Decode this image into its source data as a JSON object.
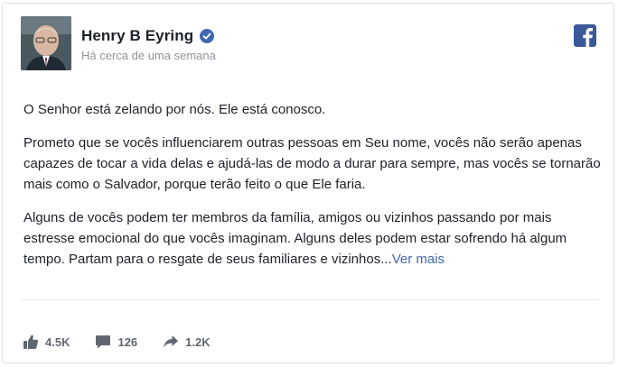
{
  "post": {
    "author": "Henry B Eyring",
    "time": "Há cerca de uma semana",
    "paragraphs": [
      "O Senhor está zelando por nós. Ele está conosco.",
      "Prometo que se vocês influenciarem outras pessoas em Seu nome, vocês não serão apenas capazes de tocar a vida delas e ajudá-las de modo a durar para sempre, mas vocês se tornarão mais como o Salvador, porque terão feito o que Ele faria.",
      "Alguns de vocês podem ter membros da família, amigos ou vizinhos passando por mais estresse emocional do que vocês imaginam. Alguns deles podem estar sofrendo há algum tempo. Partam para o resgate de seus familiares e vizinhos..."
    ],
    "see_more": "Ver mais"
  },
  "stats": {
    "likes": "4.5K",
    "comments": "126",
    "shares": "1.2K"
  },
  "icons": {
    "verified": "verified-badge-icon",
    "platform": "facebook-icon",
    "like": "thumbs-up-icon",
    "comment": "comment-icon",
    "share": "share-arrow-icon"
  },
  "colors": {
    "link": "#4267b2",
    "facebook": "#3b5998",
    "verified": "#4267b2",
    "muted": "#90949c"
  }
}
